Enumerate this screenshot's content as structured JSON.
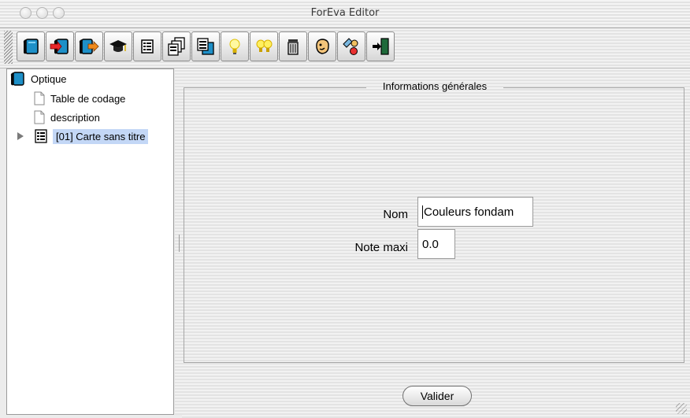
{
  "window": {
    "title": "ForEva Editor"
  },
  "toolbar": {
    "buttons": [
      {
        "icon": "book-icon"
      },
      {
        "icon": "book-import-icon"
      },
      {
        "icon": "book-export-icon"
      },
      {
        "icon": "graduation-cap-icon"
      },
      {
        "icon": "card-icon"
      },
      {
        "icon": "cards-stack-icon"
      },
      {
        "icon": "card-copy-icon"
      },
      {
        "icon": "lightbulb-icon"
      },
      {
        "icon": "lightbulbs-icon"
      },
      {
        "icon": "trash-icon"
      },
      {
        "icon": "face-icon"
      },
      {
        "icon": "tools-icon"
      },
      {
        "icon": "exit-door-icon"
      }
    ]
  },
  "tree": {
    "root": "Optique",
    "items": [
      "Table de codage",
      "description",
      "[01] Carte sans titre"
    ]
  },
  "panel": {
    "group_title": "Informations générales",
    "nom_label": "Nom",
    "nom_value": "Couleurs fondam",
    "note_label": "Note maxi",
    "note_value": "0.0",
    "submit_label": "Valider"
  },
  "colors": {
    "selection": "#c3d7f6",
    "background": "#ececec"
  }
}
